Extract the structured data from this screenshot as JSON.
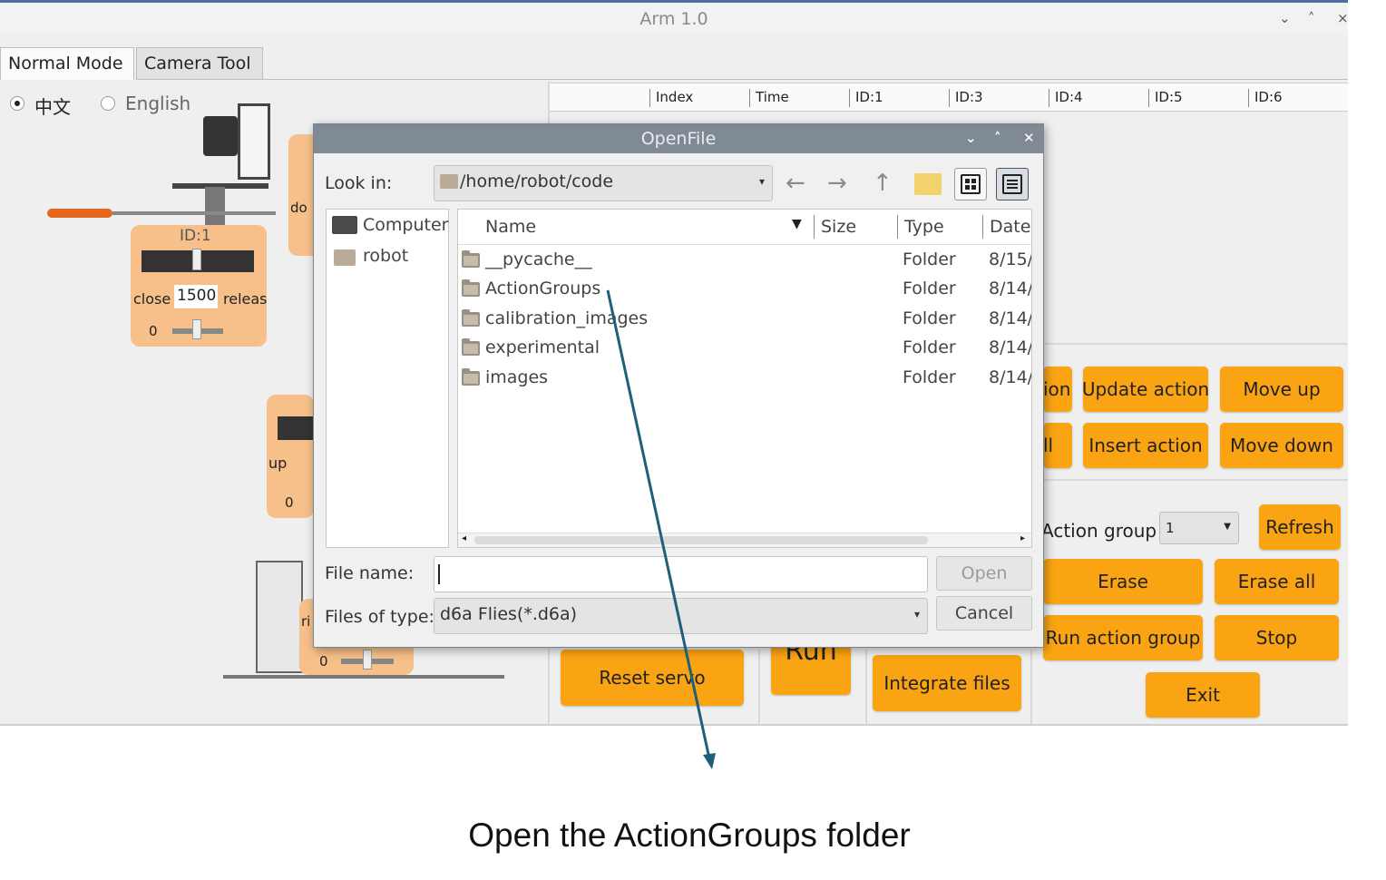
{
  "window": {
    "title": "Arm 1.0",
    "controls": [
      "⌄",
      "˄",
      "×"
    ]
  },
  "tabs": [
    {
      "label": "Normal Mode"
    },
    {
      "label": "Camera Tool"
    }
  ],
  "language": {
    "options": [
      {
        "label": "中文",
        "selected": true
      },
      {
        "label": "English",
        "selected": false
      }
    ]
  },
  "servo_panel": {
    "id_label": "ID:1",
    "close_label": "close",
    "value": "1500",
    "release_label": "releas",
    "offset": "0",
    "do_label": "do",
    "up_label": "up",
    "up_offset": "0",
    "ri_label": "ri",
    "bottom_offset": "0"
  },
  "table": {
    "columns": [
      "Index",
      "Time",
      "ID:1",
      "ID:3",
      "ID:4",
      "ID:5",
      "ID:6"
    ]
  },
  "buttons": {
    "partial_ion": "ion",
    "update_action": "Update action",
    "move_up": "Move up",
    "partial_ll": "ll",
    "insert_action": "Insert action",
    "move_down": "Move down",
    "action_group_label": "Action group",
    "action_group_value": "1",
    "refresh": "Refresh",
    "erase": "Erase",
    "erase_all": "Erase all",
    "run_action_group": "Run action group",
    "stop": "Stop",
    "exit": "Exit",
    "reset_servo": "Reset servo",
    "run": "Run",
    "integrate_files": "Integrate files"
  },
  "dialog": {
    "title": "OpenFile",
    "look_in_label": "Look in:",
    "look_in_path": "/home/robot/code",
    "places": [
      {
        "label": "Computer",
        "icon": "computer-icon"
      },
      {
        "label": "robot",
        "icon": "folder-icon"
      }
    ],
    "columns": {
      "name": "Name",
      "size": "Size",
      "type": "Type",
      "date": "Date"
    },
    "files": [
      {
        "name": "__pycache__",
        "type": "Folder",
        "date": "8/15/"
      },
      {
        "name": "ActionGroups",
        "type": "Folder",
        "date": "8/14/"
      },
      {
        "name": "calibration_images",
        "type": "Folder",
        "date": "8/14/"
      },
      {
        "name": "experimental",
        "type": "Folder",
        "date": "8/14/"
      },
      {
        "name": "images",
        "type": "Folder",
        "date": "8/14/"
      }
    ],
    "file_name_label": "File name:",
    "file_name_value": "",
    "files_of_type_label": "Files of type:",
    "files_of_type_value": "d6a Flies(*.d6a)",
    "open_button": "Open",
    "cancel_button": "Cancel"
  },
  "annotation": {
    "caption": "Open the ActionGroups folder",
    "arrow_color": "#1f5f7a"
  }
}
